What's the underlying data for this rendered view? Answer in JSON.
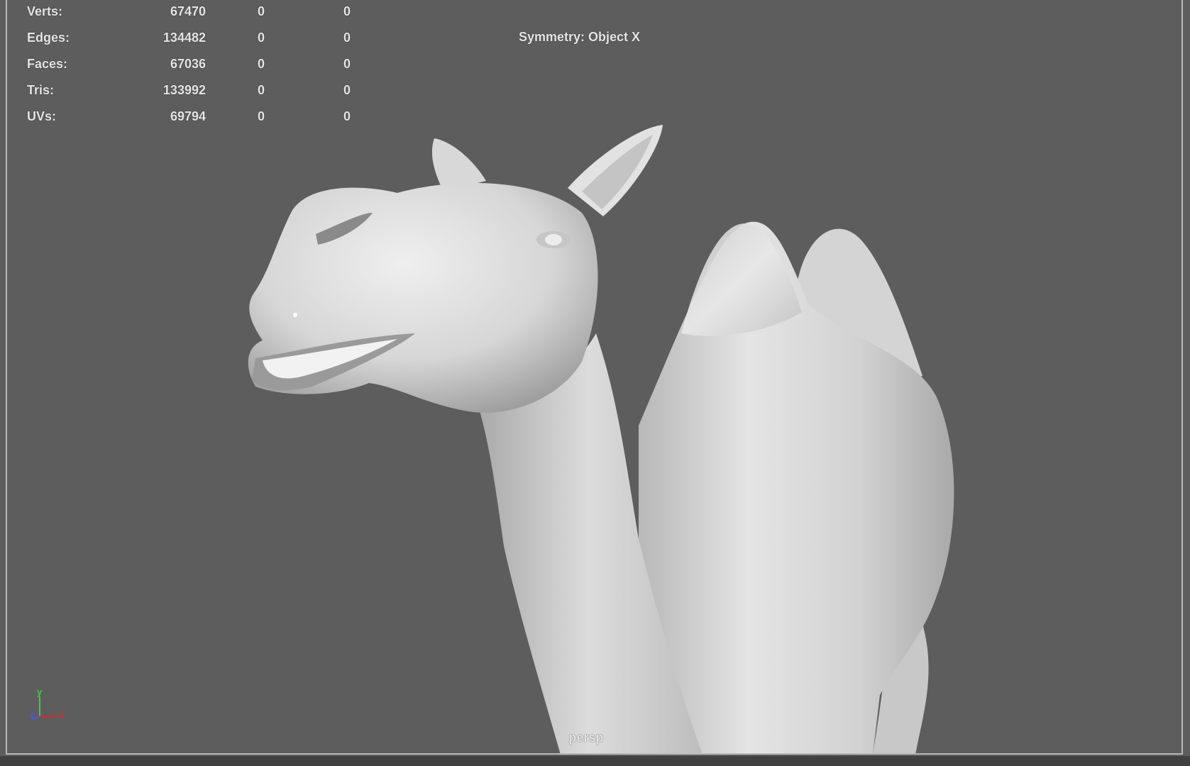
{
  "hud": {
    "rows": [
      {
        "label": "Verts:",
        "total": "67470",
        "selected": "0",
        "component": "0"
      },
      {
        "label": "Edges:",
        "total": "134482",
        "selected": "0",
        "component": "0"
      },
      {
        "label": "Faces:",
        "total": "67036",
        "selected": "0",
        "component": "0"
      },
      {
        "label": "Tris:",
        "total": "133992",
        "selected": "0",
        "component": "0"
      },
      {
        "label": "UVs:",
        "total": "69794",
        "selected": "0",
        "component": "0"
      }
    ]
  },
  "symmetry": "Symmetry: Object X",
  "camera": "persp",
  "axes": {
    "y": "y",
    "z": "z",
    "x": "x",
    "y_color": "#3fcf3f",
    "z_color": "#3a5cff",
    "x_color": "#e02828"
  },
  "viewport": {
    "background": "#5d5d5d",
    "model_icon": "camel-3d-model"
  }
}
